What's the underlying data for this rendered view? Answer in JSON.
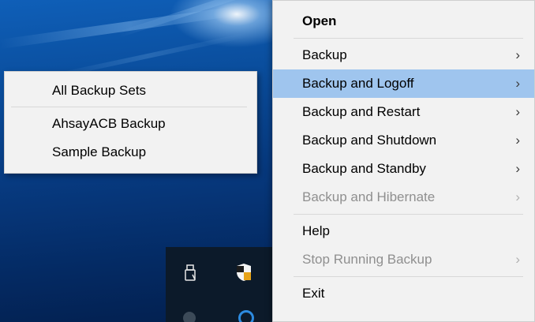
{
  "tray_menu": {
    "items": [
      {
        "label": "Open",
        "bold": true,
        "has_submenu": false,
        "enabled": true
      },
      {
        "separator": true
      },
      {
        "label": "Backup",
        "bold": false,
        "has_submenu": true,
        "enabled": true
      },
      {
        "label": "Backup and Logoff",
        "bold": false,
        "has_submenu": true,
        "enabled": true,
        "highlighted": true
      },
      {
        "label": "Backup and Restart",
        "bold": false,
        "has_submenu": true,
        "enabled": true
      },
      {
        "label": "Backup and Shutdown",
        "bold": false,
        "has_submenu": true,
        "enabled": true
      },
      {
        "label": "Backup and Standby",
        "bold": false,
        "has_submenu": true,
        "enabled": true
      },
      {
        "label": "Backup and Hibernate",
        "bold": false,
        "has_submenu": true,
        "enabled": false
      },
      {
        "separator": true
      },
      {
        "label": "Help",
        "bold": false,
        "has_submenu": false,
        "enabled": true
      },
      {
        "label": "Stop Running Backup",
        "bold": false,
        "has_submenu": true,
        "enabled": false
      },
      {
        "separator": true
      },
      {
        "label": "Exit",
        "bold": false,
        "has_submenu": false,
        "enabled": true
      }
    ],
    "chevron": "›"
  },
  "submenu": {
    "items": [
      {
        "label": "All Backup Sets"
      },
      {
        "separator": true
      },
      {
        "label": "AhsayACB Backup"
      },
      {
        "label": "Sample Backup"
      }
    ]
  },
  "taskbar": {
    "icons": [
      "usb-drive-icon",
      "security-shield-icon",
      "tray-app-icon",
      "network-circle-icon"
    ]
  },
  "colors": {
    "menu_background": "#f2f2f2",
    "highlight": "#9fc5ee",
    "disabled_text": "#8f8f8f",
    "desktop_blue": "#0a4d9c",
    "taskbar": "#0c1a2a"
  }
}
